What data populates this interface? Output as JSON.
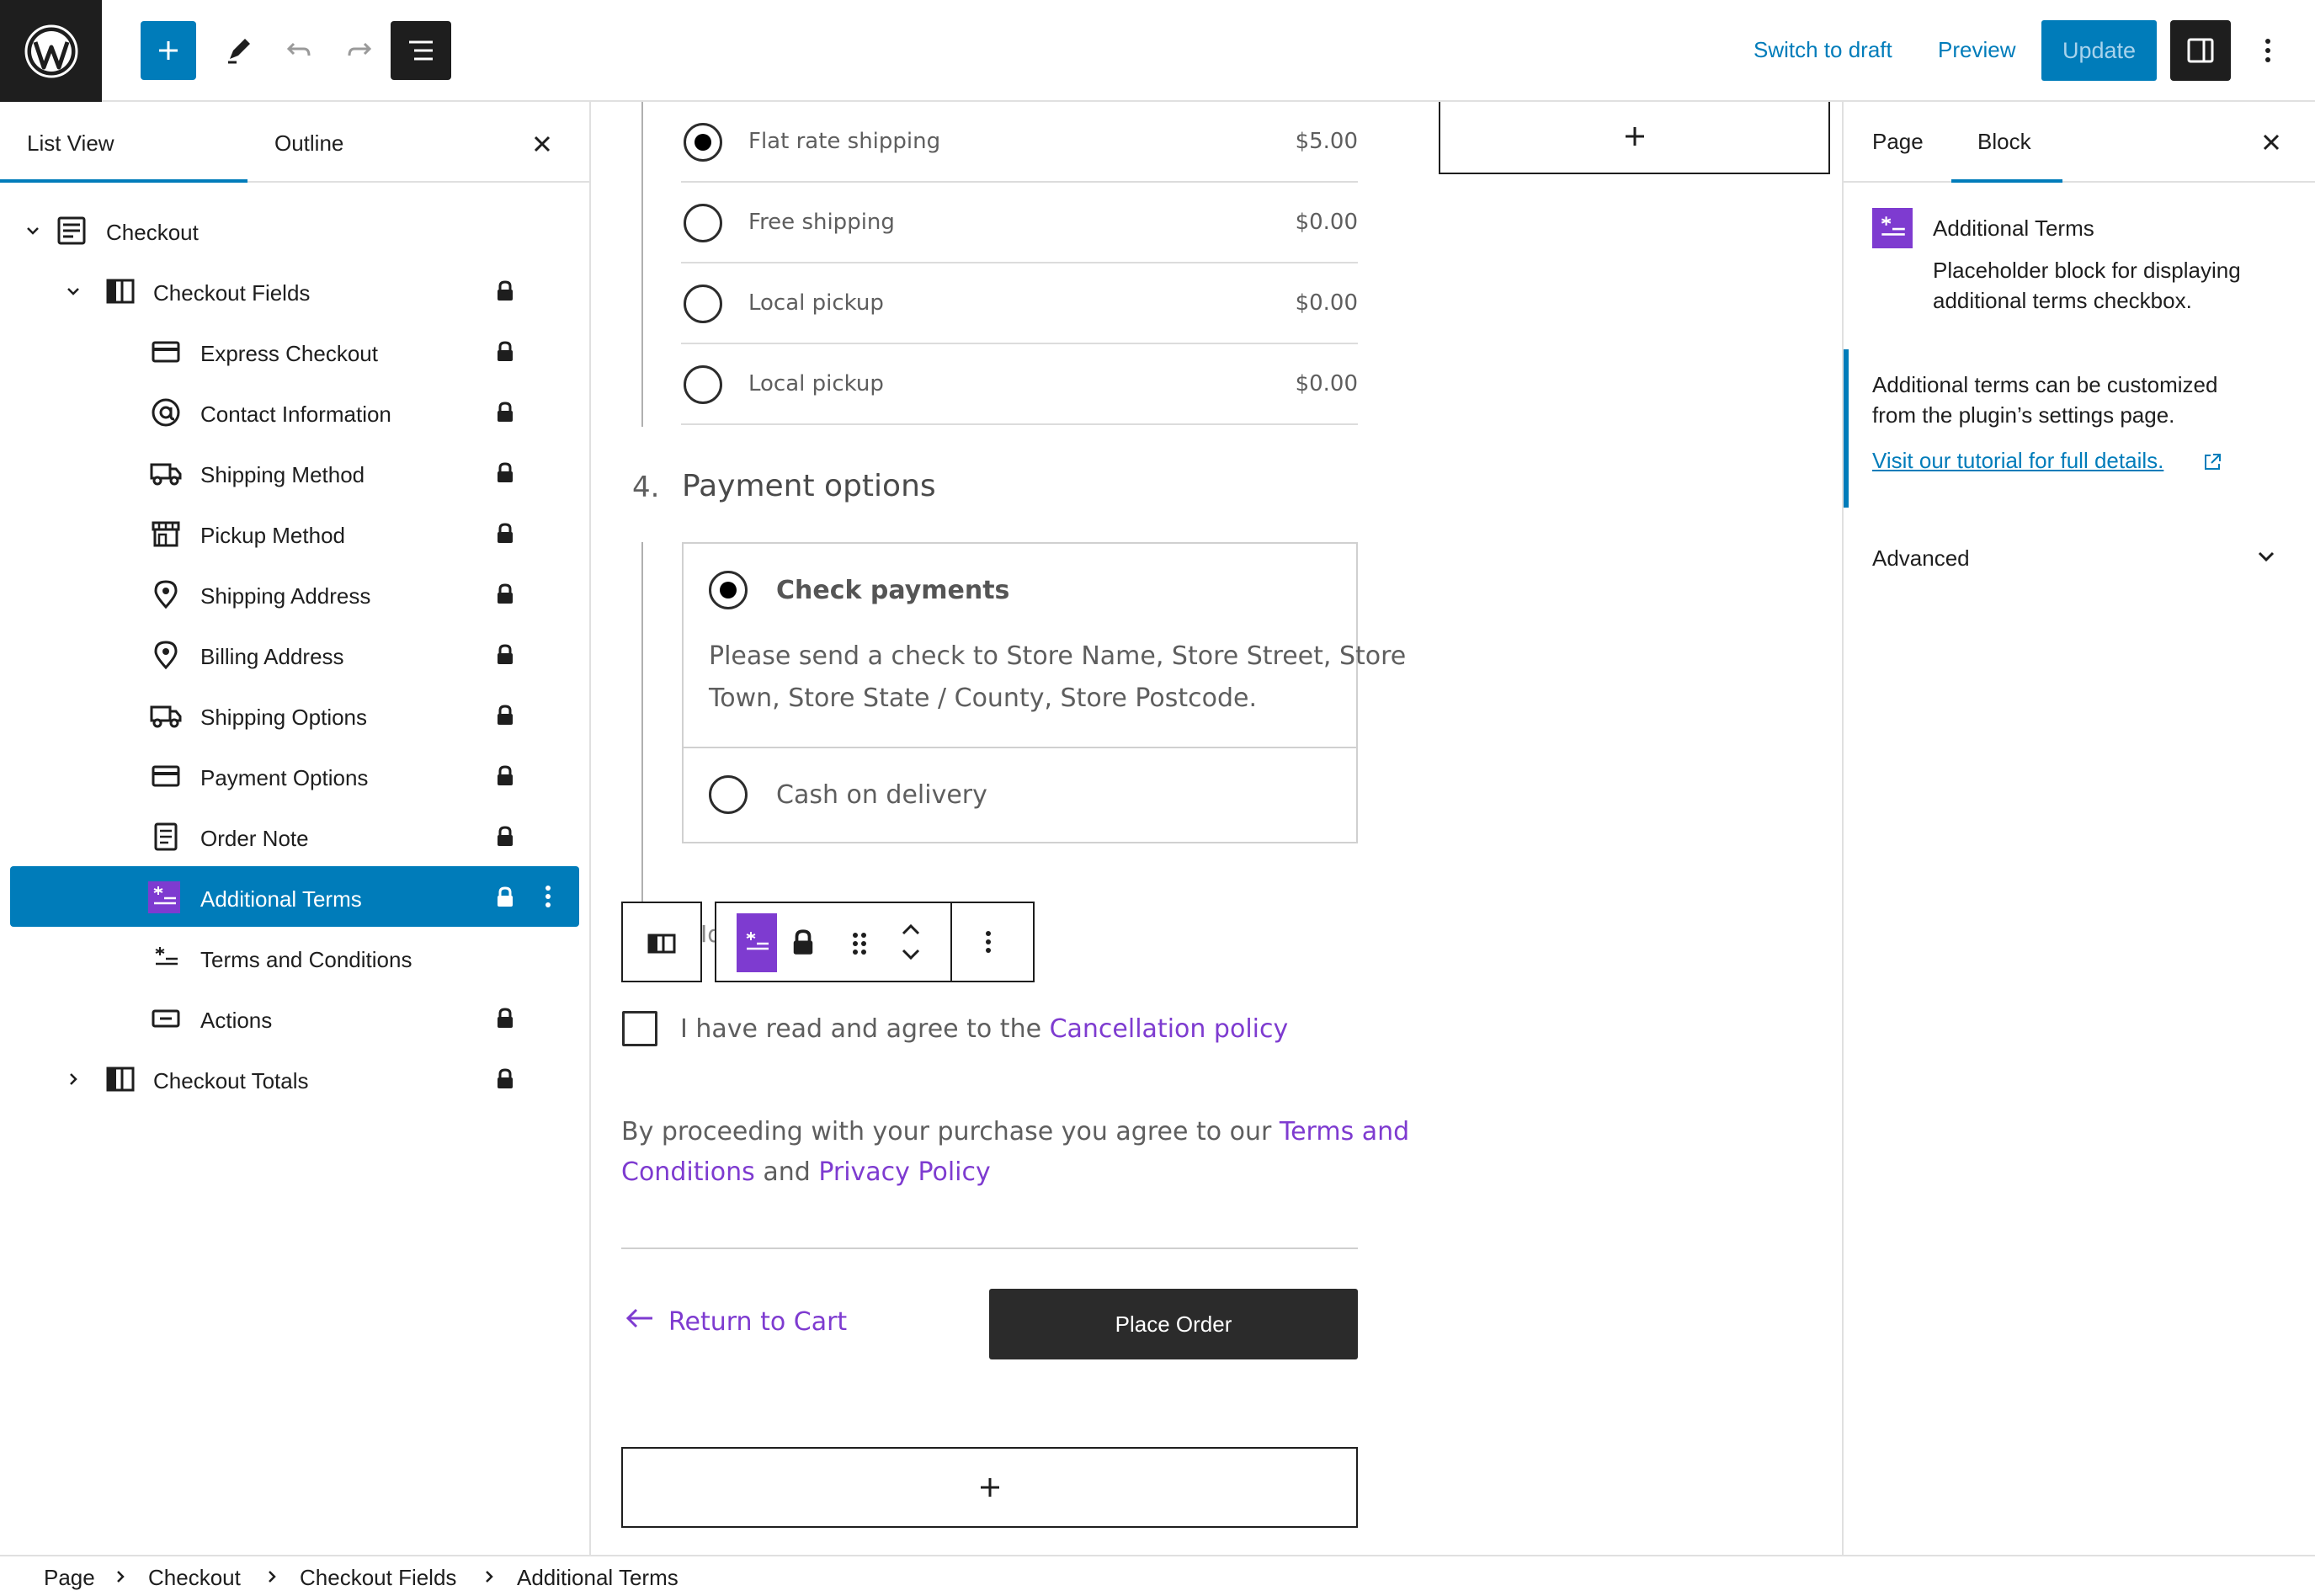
{
  "topbar": {
    "switch_to_draft": "Switch to draft",
    "preview": "Preview",
    "update": "Update"
  },
  "left_panel": {
    "tabs": [
      "List View",
      "Outline"
    ],
    "tree": [
      {
        "label": "Checkout",
        "icon": "checkout-page-icon",
        "locked": false
      },
      {
        "label": "Checkout Fields",
        "icon": "columns-icon",
        "locked": true
      },
      {
        "label": "Express Checkout",
        "icon": "card-icon",
        "locked": true
      },
      {
        "label": "Contact Information",
        "icon": "at-sign-icon",
        "locked": true
      },
      {
        "label": "Shipping Method",
        "icon": "truck-icon",
        "locked": true
      },
      {
        "label": "Pickup Method",
        "icon": "store-icon",
        "locked": true
      },
      {
        "label": "Shipping Address",
        "icon": "map-pin-icon",
        "locked": true
      },
      {
        "label": "Billing Address",
        "icon": "map-pin-icon",
        "locked": true
      },
      {
        "label": "Shipping Options",
        "icon": "truck-icon",
        "locked": true
      },
      {
        "label": "Payment Options",
        "icon": "card-icon",
        "locked": true
      },
      {
        "label": "Order Note",
        "icon": "note-icon",
        "locked": true
      },
      {
        "label": "Additional Terms",
        "icon": "terms-icon",
        "locked": true,
        "selected": true
      },
      {
        "label": "Terms and Conditions",
        "icon": "terms-icon",
        "locked": false
      },
      {
        "label": "Actions",
        "icon": "button-icon",
        "locked": true
      },
      {
        "label": "Checkout Totals",
        "icon": "columns-icon",
        "locked": true
      }
    ]
  },
  "canvas": {
    "shipping_options": [
      {
        "name": "Flat rate shipping",
        "price": "$5.00",
        "selected": true
      },
      {
        "name": "Free shipping",
        "price": "$0.00",
        "selected": false
      },
      {
        "name": "Local pickup",
        "price": "$0.00",
        "selected": false
      },
      {
        "name": "Local pickup",
        "price": "$0.00",
        "selected": false
      }
    ],
    "payment_step_number": "4.",
    "payment_heading": "Payment options",
    "payment_methods": [
      {
        "name": "Check payments",
        "selected": true,
        "description_line1": "Please send a check to Store Name, Store Street, Store",
        "description_line2": "Town, Store State / County, Store Postcode."
      },
      {
        "name": "Cash on delivery",
        "selected": false
      }
    ],
    "toolbar_partial_text": "Id",
    "terms_checkbox_text": "I have read and agree to the ",
    "terms_checkbox_link": "Cancellation policy",
    "proceed_text_1": "By proceeding with your purchase you agree to our ",
    "proceed_link_terms_1": "Terms and",
    "proceed_link_terms_2": "Conditions",
    "proceed_text_and": " and ",
    "proceed_link_privacy": "Privacy Policy",
    "return_to_cart": "Return to Cart",
    "place_order": "Place Order"
  },
  "right_panel": {
    "tabs": [
      "Page",
      "Block"
    ],
    "block_title": "Additional Terms",
    "block_desc_1": "Placeholder block for displaying",
    "block_desc_2": "additional terms checkbox.",
    "notice_line1": "Additional terms can be customized",
    "notice_line2": "from the plugin’s settings page.",
    "notice_link": "Visit our tutorial for full details.",
    "advanced": "Advanced"
  },
  "breadcrumb": [
    "Page",
    "Checkout",
    "Checkout Fields",
    "Additional Terms"
  ],
  "colors": {
    "accent": "#007cba",
    "link_purple": "#7e3bd0",
    "dark": "#1e1e1e",
    "block_icon": "#7e3bd0"
  }
}
